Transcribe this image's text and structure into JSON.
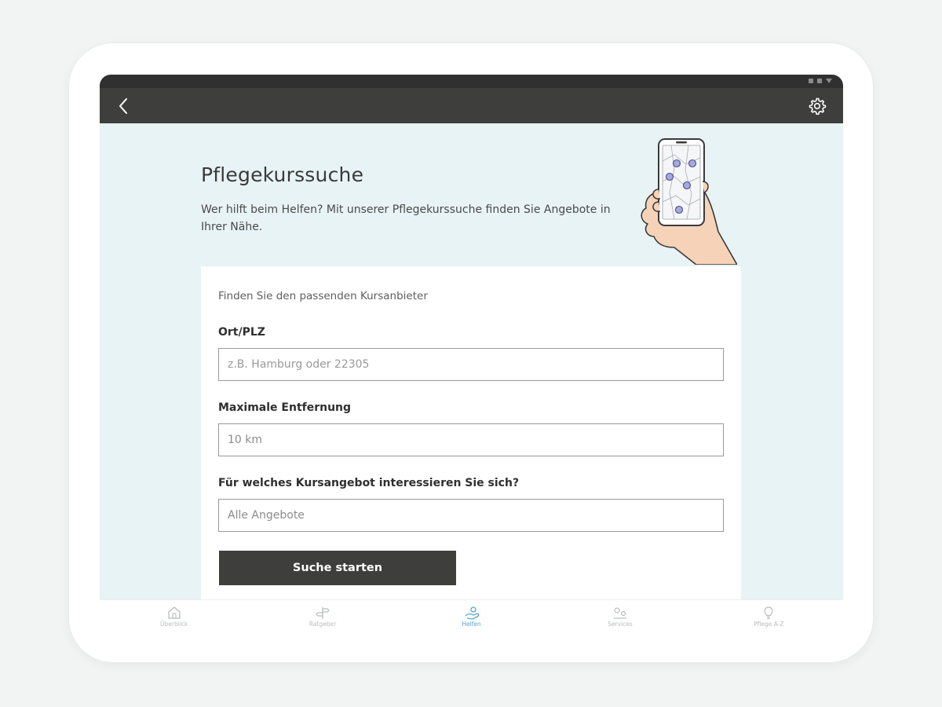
{
  "header": {
    "back_label": "back",
    "settings_label": "settings"
  },
  "page": {
    "title": "Pflegekurssuche",
    "intro": "Wer hilft beim Helfen? Mit unserer Pflegekurssuche finden Sie Angebote in Ihrer Nähe."
  },
  "form": {
    "hint": "Finden Sie den passenden Kursanbieter",
    "location": {
      "label": "Ort/PLZ",
      "placeholder": "z.B. Hamburg oder 22305",
      "value": ""
    },
    "distance": {
      "label": "Maximale Entfernung",
      "selected": "10 km"
    },
    "course": {
      "label": "Für welches Kursangebot interessieren Sie sich?",
      "selected": "Alle Angebote"
    },
    "submit_label": "Suche starten"
  },
  "nav": {
    "items": [
      {
        "label": "Überblick",
        "icon": "home-icon",
        "active": false
      },
      {
        "label": "Ratgeber",
        "icon": "signpost-icon",
        "active": false
      },
      {
        "label": "Helfen",
        "icon": "helping-hand-icon",
        "active": true
      },
      {
        "label": "Services",
        "icon": "services-icon",
        "active": false
      },
      {
        "label": "Pflege A-Z",
        "icon": "lightbulb-icon",
        "active": false
      }
    ]
  },
  "colors": {
    "background": "#e8f3f6",
    "appbar": "#3e3f3d",
    "accent_active": "#5aa7c9"
  }
}
